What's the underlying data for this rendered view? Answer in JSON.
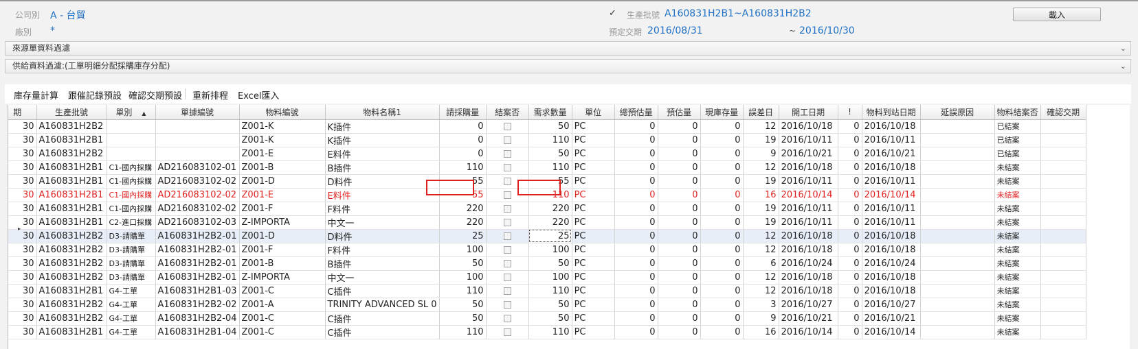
{
  "header": {
    "company_label": "公司別",
    "company_value": "A - 台貿",
    "factory_label": "廠別",
    "factory_value": "*",
    "batch_checked": true,
    "batch_label": "生產批號",
    "batch_value": "A160831H2B1~A160831H2B2",
    "delivery_label": "預定交期",
    "delivery_from": "2016/08/31",
    "delivery_sep": "~",
    "delivery_to": "2016/10/30",
    "import_button": "載入"
  },
  "filters": {
    "source_filter": "來源單資料過濾",
    "supply_filter": "供給資料過濾:(工單明細分配採購庫存分配)"
  },
  "toolbar": {
    "items": [
      "庫存量計算",
      "跟催記錄預設",
      "確認交期預設",
      "重新排程",
      "Excel匯入"
    ]
  },
  "grid": {
    "columns": [
      "期",
      "生產批號",
      "單別",
      "單據編號",
      "物料編號",
      "物料名稱1",
      "請採購量",
      "結案否",
      "需求數量",
      "單位",
      "總預估量",
      "預估量",
      "現庫存量",
      "誤差日",
      "開工日期",
      "!",
      "物料到站日期",
      "延誤原因",
      "物料結案否",
      "確認交期"
    ],
    "sort_indicator": "▲",
    "row_pointer": "▸",
    "rows": [
      {
        "p": "30",
        "batch": "A160831H2B2",
        "type": "",
        "doc": "",
        "item": "Z001-K",
        "name": "K插件",
        "req": "0",
        "req_qty": "50",
        "unit": "PC",
        "tot": "0",
        "est": "0",
        "stock": "0",
        "diff": "12",
        "start": "2016/10/18",
        "flag": "0",
        "arrive": "2016/10/18",
        "reason": "",
        "closed": "已結案",
        "confirm": ""
      },
      {
        "p": "30",
        "batch": "A160831H2B1",
        "type": "",
        "doc": "",
        "item": "Z001-K",
        "name": "K插件",
        "req": "0",
        "req_qty": "110",
        "unit": "PC",
        "tot": "0",
        "est": "0",
        "stock": "0",
        "diff": "19",
        "start": "2016/10/11",
        "flag": "0",
        "arrive": "2016/10/11",
        "reason": "",
        "closed": "已結案",
        "confirm": ""
      },
      {
        "p": "30",
        "batch": "A160831H2B2",
        "type": "",
        "doc": "",
        "item": "Z001-E",
        "name": "E料件",
        "req": "0",
        "req_qty": "50",
        "unit": "PC",
        "tot": "0",
        "est": "0",
        "stock": "0",
        "diff": "9",
        "start": "2016/10/21",
        "flag": "0",
        "arrive": "2016/10/21",
        "reason": "",
        "closed": "已結案",
        "confirm": ""
      },
      {
        "p": "30",
        "batch": "A160831H2B1",
        "type": "C1-國內採購",
        "doc": "AD216083102-01",
        "item": "Z001-B",
        "name": "B插件",
        "req": "110",
        "req_qty": "110",
        "unit": "PC",
        "tot": "0",
        "est": "0",
        "stock": "0",
        "diff": "12",
        "start": "2016/10/18",
        "flag": "0",
        "arrive": "2016/10/18",
        "reason": "",
        "closed": "未結案",
        "confirm": ""
      },
      {
        "p": "30",
        "batch": "A160831H2B1",
        "type": "C1-國內採購",
        "doc": "AD216083102-02",
        "item": "Z001-D",
        "name": "D料件",
        "req": "55",
        "req_qty": "55",
        "unit": "PC",
        "tot": "0",
        "est": "0",
        "stock": "0",
        "diff": "19",
        "start": "2016/10/11",
        "flag": "0",
        "arrive": "2016/10/11",
        "reason": "",
        "closed": "未結案",
        "confirm": ""
      },
      {
        "p": "30",
        "batch": "A160831H2B1",
        "type": "C1-國內採購",
        "doc": "AD216083102-02",
        "item": "Z001-E",
        "name": "E料件",
        "req": "55",
        "req_qty": "110",
        "unit": "PC",
        "tot": "0",
        "est": "0",
        "stock": "0",
        "diff": "16",
        "start": "2016/10/14",
        "flag": "0",
        "arrive": "2016/10/14",
        "reason": "",
        "closed": "未結案",
        "confirm": "",
        "highlight": true
      },
      {
        "p": "30",
        "batch": "A160831H2B1",
        "type": "C1-國內採購",
        "doc": "AD216083102-02",
        "item": "Z001-F",
        "name": "F料件",
        "req": "220",
        "req_qty": "220",
        "unit": "PC",
        "tot": "0",
        "est": "0",
        "stock": "0",
        "diff": "19",
        "start": "2016/10/11",
        "flag": "0",
        "arrive": "2016/10/11",
        "reason": "",
        "closed": "未結案",
        "confirm": ""
      },
      {
        "p": "30",
        "batch": "A160831H2B1",
        "type": "C2-進口採購",
        "doc": "AD216083102-03",
        "item": "Z-IMPORTA",
        "name": "中文一",
        "req": "220",
        "req_qty": "220",
        "unit": "PC",
        "tot": "0",
        "est": "0",
        "stock": "0",
        "diff": "19",
        "start": "2016/10/11",
        "flag": "0",
        "arrive": "2016/10/11",
        "reason": "",
        "closed": "未結案",
        "confirm": ""
      },
      {
        "p": "30",
        "batch": "A160831H2B2",
        "type": "D3-請購單",
        "doc": "A160831H2B2-01",
        "item": "Z001-D",
        "name": "D料件",
        "req": "25",
        "req_qty": "25",
        "unit": "PC",
        "tot": "0",
        "est": "0",
        "stock": "0",
        "diff": "12",
        "start": "2016/10/18",
        "flag": "0",
        "arrive": "2016/10/18",
        "reason": "",
        "closed": "未結案",
        "confirm": "",
        "selected": true
      },
      {
        "p": "30",
        "batch": "A160831H2B2",
        "type": "D3-請購單",
        "doc": "A160831H2B2-01",
        "item": "Z001-F",
        "name": "F料件",
        "req": "100",
        "req_qty": "100",
        "unit": "PC",
        "tot": "0",
        "est": "0",
        "stock": "0",
        "diff": "12",
        "start": "2016/10/18",
        "flag": "0",
        "arrive": "2016/10/18",
        "reason": "",
        "closed": "未結案",
        "confirm": ""
      },
      {
        "p": "30",
        "batch": "A160831H2B2",
        "type": "D3-請購單",
        "doc": "A160831H2B2-01",
        "item": "Z001-B",
        "name": "B插件",
        "req": "50",
        "req_qty": "50",
        "unit": "PC",
        "tot": "0",
        "est": "0",
        "stock": "0",
        "diff": "6",
        "start": "2016/10/24",
        "flag": "0",
        "arrive": "2016/10/24",
        "reason": "",
        "closed": "未結案",
        "confirm": ""
      },
      {
        "p": "30",
        "batch": "A160831H2B2",
        "type": "D3-請購單",
        "doc": "A160831H2B2-01",
        "item": "Z-IMPORTA",
        "name": "中文一",
        "req": "100",
        "req_qty": "100",
        "unit": "PC",
        "tot": "0",
        "est": "0",
        "stock": "0",
        "diff": "12",
        "start": "2016/10/18",
        "flag": "0",
        "arrive": "2016/10/18",
        "reason": "",
        "closed": "未結案",
        "confirm": ""
      },
      {
        "p": "30",
        "batch": "A160831H2B1",
        "type": "G4-工單",
        "doc": "A160831H2B1-03",
        "item": "Z001-C",
        "name": "C插件",
        "req": "110",
        "req_qty": "110",
        "unit": "PC",
        "tot": "0",
        "est": "0",
        "stock": "0",
        "diff": "12",
        "start": "2016/10/18",
        "flag": "0",
        "arrive": "2016/10/18",
        "reason": "",
        "closed": "未結案",
        "confirm": ""
      },
      {
        "p": "30",
        "batch": "A160831H2B2",
        "type": "G4-工單",
        "doc": "A160831H2B2-02",
        "item": "Z001-A",
        "name": "TRINITY ADVANCED SL 0",
        "req": "50",
        "req_qty": "50",
        "unit": "PC",
        "tot": "0",
        "est": "0",
        "stock": "0",
        "diff": "3",
        "start": "2016/10/27",
        "flag": "0",
        "arrive": "2016/10/27",
        "reason": "",
        "closed": "未結案",
        "confirm": ""
      },
      {
        "p": "30",
        "batch": "A160831H2B2",
        "type": "G4-工單",
        "doc": "A160831H2B2-04",
        "item": "Z001-C",
        "name": "C插件",
        "req": "50",
        "req_qty": "50",
        "unit": "PC",
        "tot": "0",
        "est": "0",
        "stock": "0",
        "diff": "9",
        "start": "2016/10/21",
        "flag": "0",
        "arrive": "2016/10/21",
        "reason": "",
        "closed": "未結案",
        "confirm": ""
      },
      {
        "p": "30",
        "batch": "A160831H2B1",
        "type": "G4-工單",
        "doc": "A160831H2B1-04",
        "item": "Z001-C",
        "name": "C插件",
        "req": "110",
        "req_qty": "110",
        "unit": "PC",
        "tot": "0",
        "est": "0",
        "stock": "0",
        "diff": "16",
        "start": "2016/10/14",
        "flag": "0",
        "arrive": "2016/10/14",
        "reason": "",
        "closed": "未結案",
        "confirm": ""
      }
    ]
  },
  "colors": {
    "accent_blue": "#1e6fc4",
    "highlight_red": "#e02020",
    "selected_row": "#e8eef8"
  }
}
